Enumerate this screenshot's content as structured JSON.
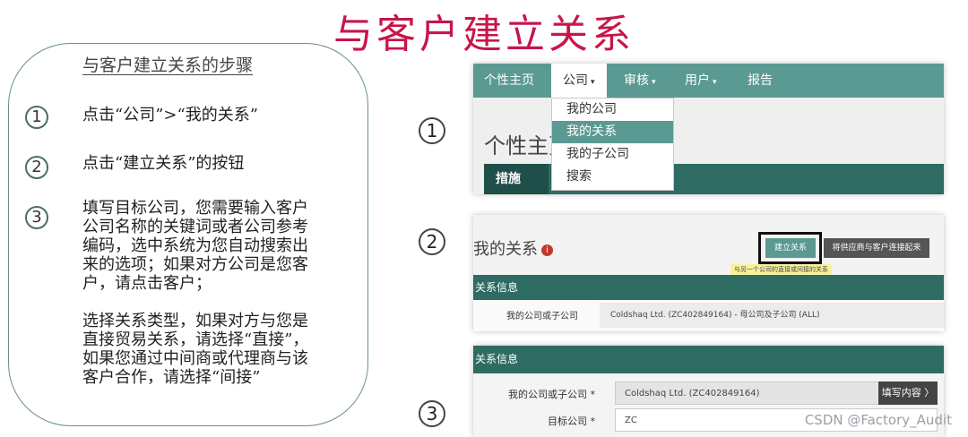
{
  "slide": {
    "title": "与客户建立关系",
    "panel_heading": "与客户建立关系的步骤",
    "steps": [
      {
        "num": "1",
        "lines": [
          "点击“公司”>“我的关系”"
        ]
      },
      {
        "num": "2",
        "lines": [
          "点击“建立关系”的按钮"
        ]
      },
      {
        "num": "3",
        "lines": [
          "填写目标公司，您需要输入客户",
          "公司名称的关键词或者公司参考",
          "编码，选中系统为您自动搜索出",
          "来的选项；如果对方公司是您客",
          "户，请点击客户；",
          "",
          "选择关系类型，如果对方与您是",
          "直接贸易关系，请选择“直接”，",
          "如果您通过中间商或代理商与该",
          "客户合作，请选择“间接”"
        ]
      }
    ],
    "right_nums": [
      "1",
      "2",
      "3"
    ]
  },
  "shot1": {
    "nav": [
      "个性主页",
      "公司",
      "审核",
      "用户",
      "报告"
    ],
    "caret": "▾",
    "dropdown": [
      "我的公司",
      "我的关系",
      "我的子公司",
      "搜索"
    ],
    "page_heading": "个性主页",
    "tab": "措施"
  },
  "shot2": {
    "title": "我的关系",
    "info_icon": "i",
    "build_button": "建立关系",
    "other_button": "将供应商与客户连接起来",
    "tooltip": "与另一个公司的直接或间接的关系",
    "section": "关系信息",
    "field_label": "我的公司或子公司",
    "field_value": "Coldshaq Ltd. (ZC402849164) - 母公司及子公司 (ALL)"
  },
  "shot3": {
    "section": "关系信息",
    "label1": "我的公司或子公司 *",
    "value1": "Coldshaq Ltd. (ZC402849164)",
    "button": "填写内容 〉",
    "label2": "目标公司 *",
    "value2": "ZC"
  },
  "watermark": "CSDN @Factory_Audit"
}
